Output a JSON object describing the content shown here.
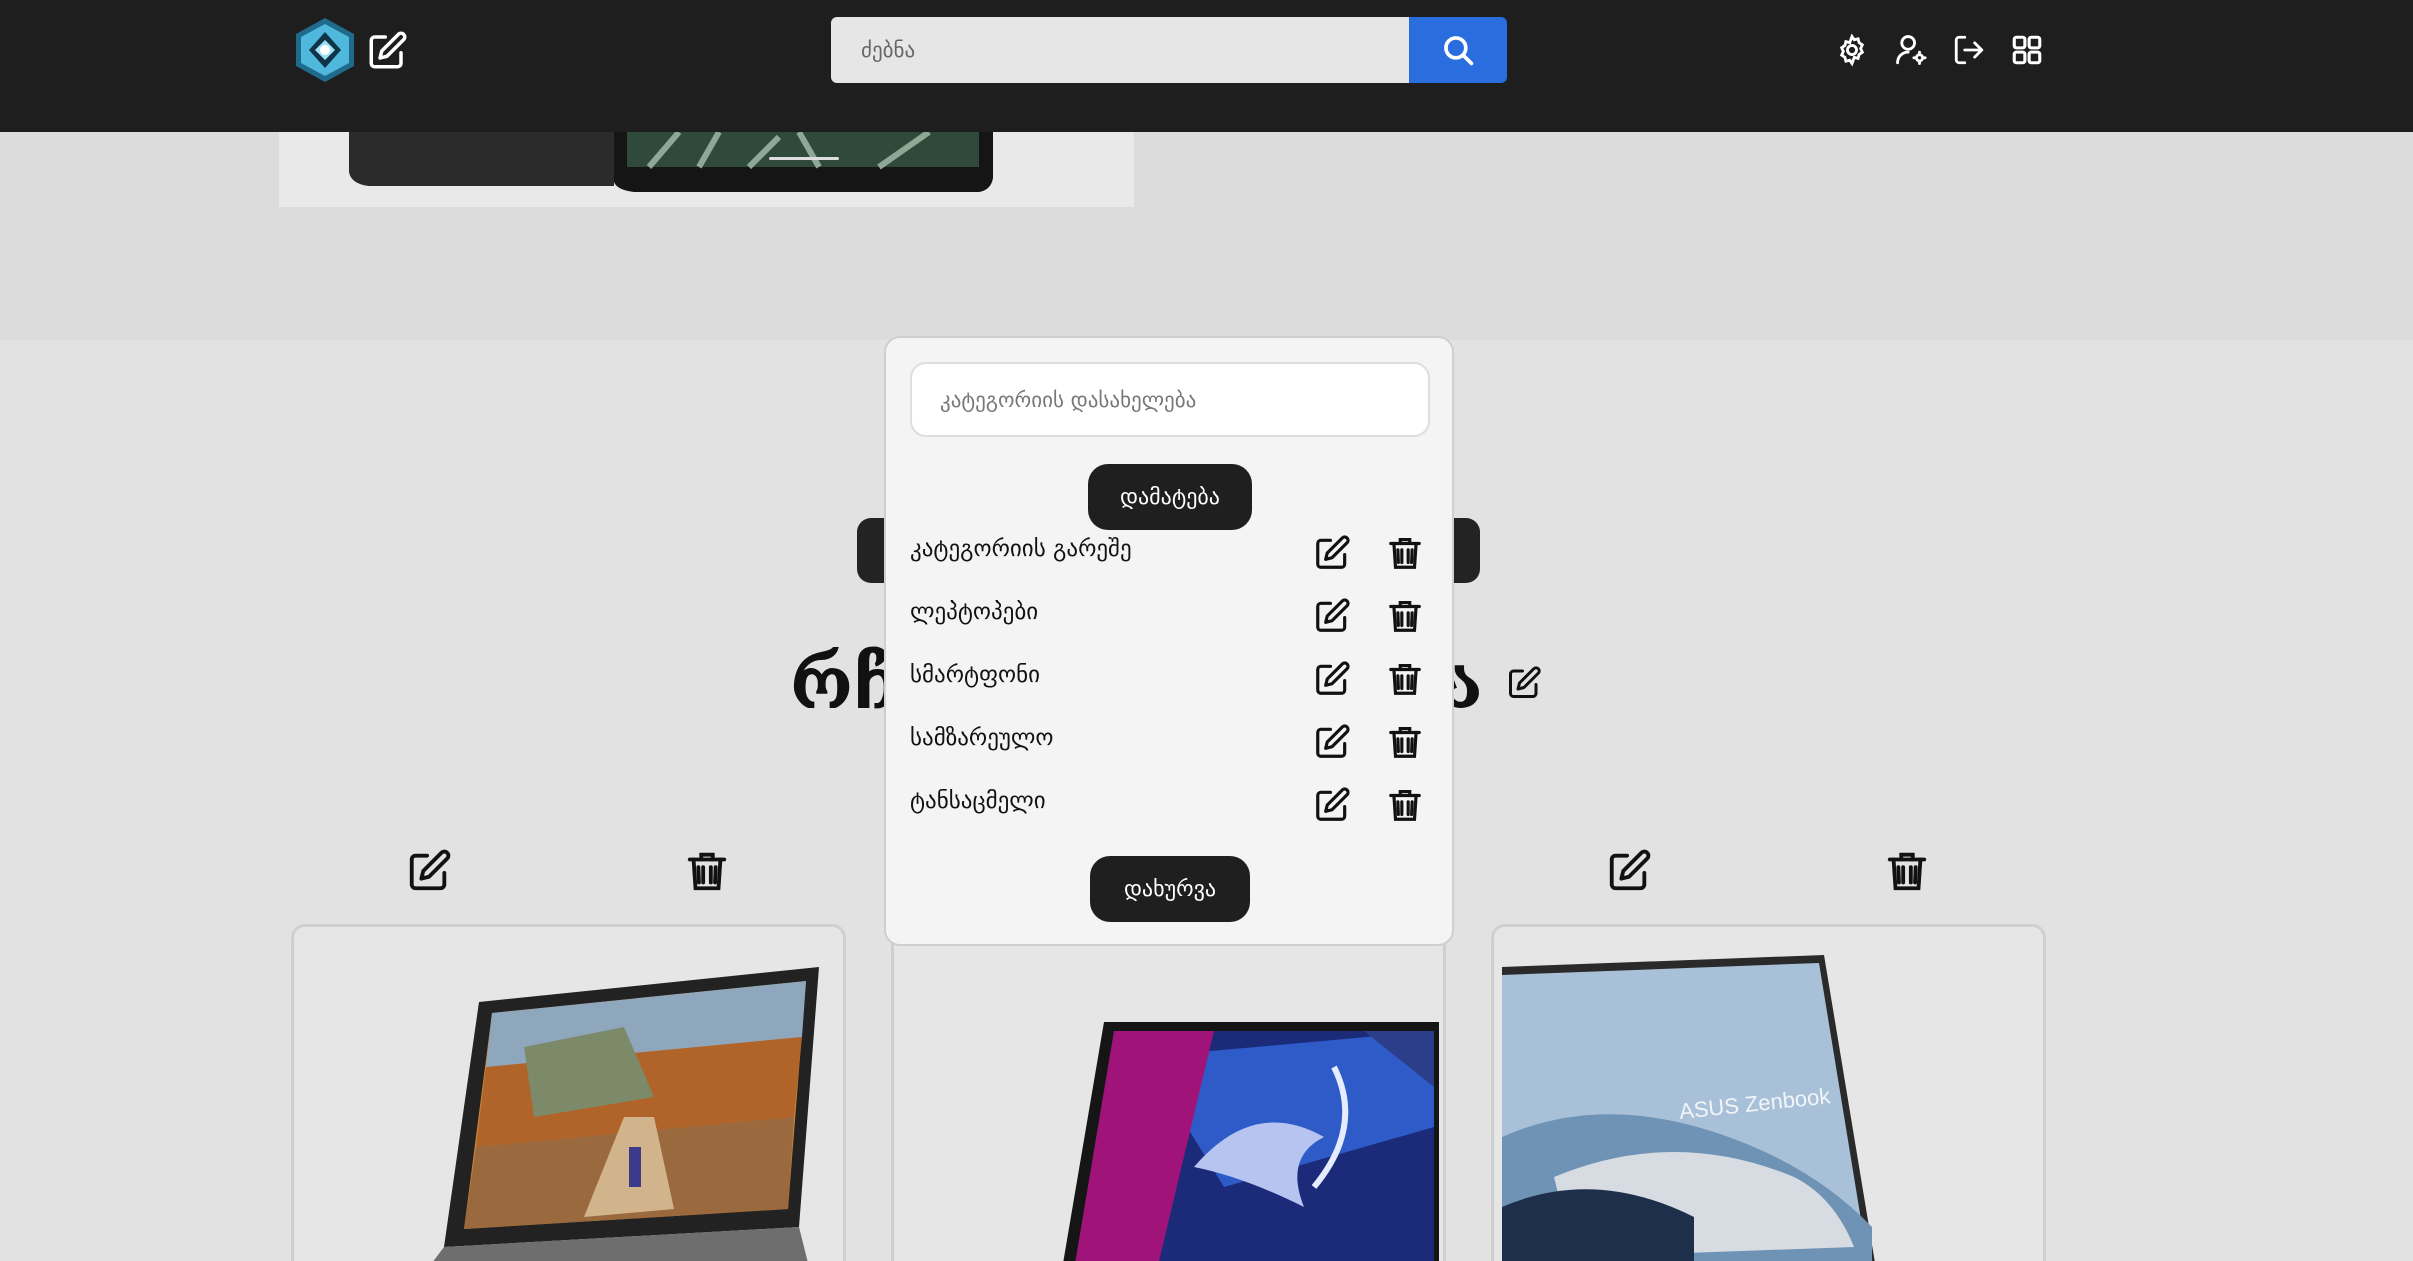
{
  "header": {
    "search_placeholder": "ძებნა",
    "icons": [
      "settings-icon",
      "user-settings-icon",
      "logout-icon",
      "apps-grid-icon"
    ]
  },
  "background": {
    "heading_left": "რჩ",
    "heading_right": "ა"
  },
  "modal": {
    "input_placeholder": "კატეგორიის დასახელება",
    "add_label": "დამატება",
    "close_label": "დახურვა",
    "categories": [
      {
        "label": "კატეგორიის გარეშე"
      },
      {
        "label": "ლეპტოპები"
      },
      {
        "label": "სმარტფონი"
      },
      {
        "label": "სამზარეულო"
      },
      {
        "label": "ტანსაცმელი"
      }
    ]
  },
  "products": [
    {
      "image": "laptop-landscape"
    },
    {
      "image": "laptop-rog"
    },
    {
      "image": "laptop-zenbook",
      "image_text": "ASUS Zenbook"
    }
  ],
  "colors": {
    "header_bg": "#1e1e1e",
    "search_button": "#2a6dde",
    "page_bg": "#e2e2e2",
    "modal_bg": "#f4f4f4",
    "button_dark": "#1f1f1f"
  }
}
